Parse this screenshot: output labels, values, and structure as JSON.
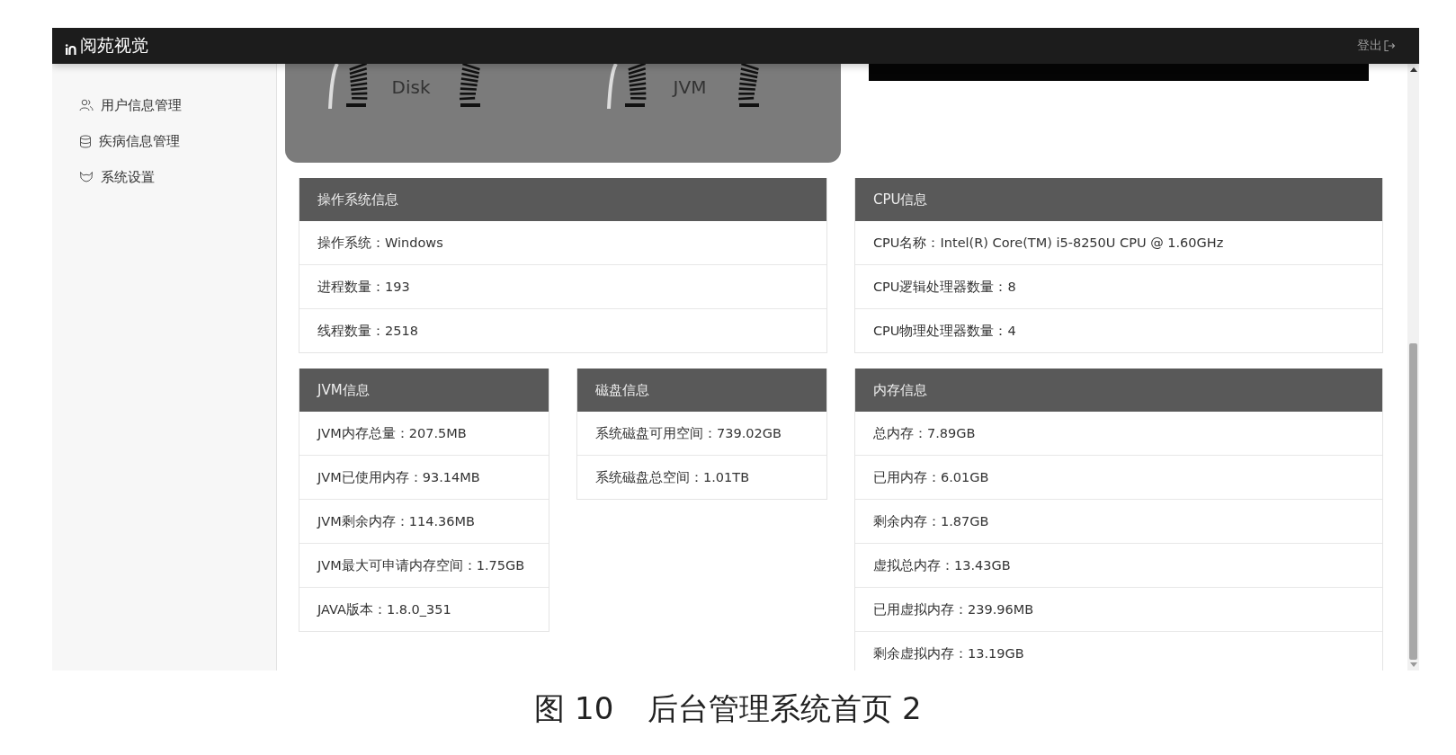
{
  "header": {
    "logo": "阅苑视觉",
    "logout": "登出"
  },
  "sidebar": {
    "items": [
      {
        "label": "用户信息管理",
        "kind": "users"
      },
      {
        "label": "疾病信息管理",
        "kind": "database"
      },
      {
        "label": "系统设置",
        "kind": "cat"
      }
    ]
  },
  "gauges": [
    {
      "label": "Disk"
    },
    {
      "label": "JVM"
    }
  ],
  "cards": [
    {
      "title": "操作系统信息",
      "rows": [
        "操作系统：Windows",
        "进程数量：193",
        "线程数量：2518"
      ]
    },
    {
      "title": "CPU信息",
      "rows": [
        "CPU名称：Intel(R) Core(TM) i5-8250U CPU @ 1.60GHz",
        "CPU逻辑处理器数量：8",
        "CPU物理处理器数量：4"
      ]
    },
    {
      "title": "JVM信息",
      "rows": [
        "JVM内存总量：207.5MB",
        "JVM已使用内存：93.14MB",
        "JVM剩余内存：114.36MB",
        "JVM最大可申请内存空间：1.75GB",
        "JAVA版本：1.8.0_351"
      ]
    },
    {
      "title": "磁盘信息",
      "rows": [
        "系统磁盘可用空间：739.02GB",
        "系统磁盘总空间：1.01TB"
      ]
    },
    {
      "title": "内存信息",
      "rows": [
        "总内存：7.89GB",
        "已用内存：6.01GB",
        "剩余内存：1.87GB",
        "虚拟总内存：13.43GB",
        "已用虚拟内存：239.96MB",
        "剩余虚拟内存：13.19GB"
      ]
    }
  ],
  "caption": {
    "number": "图 10",
    "text": "后台管理系统首页 2"
  }
}
